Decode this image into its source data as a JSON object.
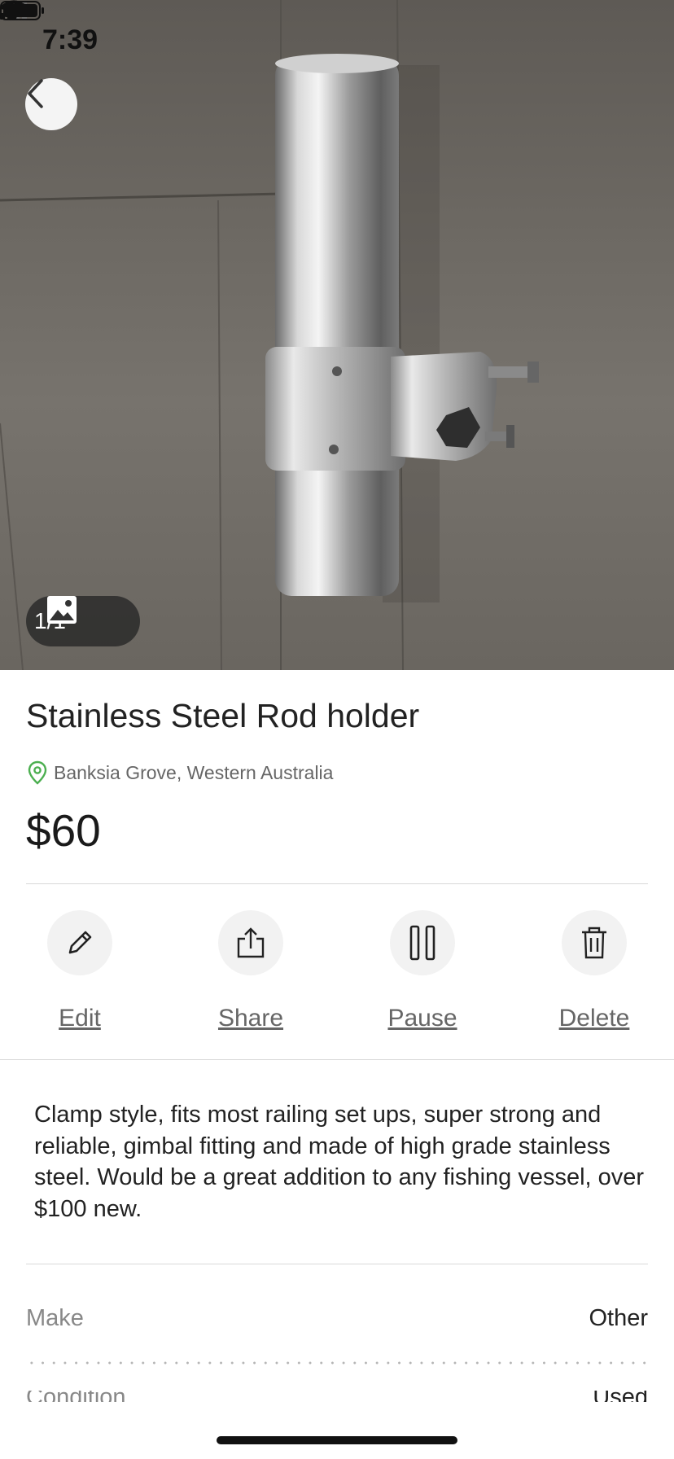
{
  "status_bar": {
    "time": "7:39"
  },
  "photo": {
    "counter": "1/1",
    "description": "stainless steel rod holder on wooden floor"
  },
  "listing": {
    "title": "Stainless Steel Rod holder",
    "location": "Banksia Grove, Western Australia",
    "price": "$60"
  },
  "actions": [
    {
      "label": "Edit",
      "icon": "pencil-icon"
    },
    {
      "label": "Share",
      "icon": "share-icon"
    },
    {
      "label": "Pause",
      "icon": "pause-icon"
    },
    {
      "label": "Delete",
      "icon": "trash-icon"
    }
  ],
  "description": "Clamp style, fits most railing set ups, super strong and reliable, gimbal fitting and made of high grade stainless steel. Would be a great addition to any fishing vessel, over $100 new.",
  "attributes": [
    {
      "key": "Make",
      "value": "Other"
    },
    {
      "key": "Condition",
      "value": "Used"
    }
  ],
  "colors": {
    "accent_green": "#4caf50",
    "muted_text": "#666666"
  }
}
